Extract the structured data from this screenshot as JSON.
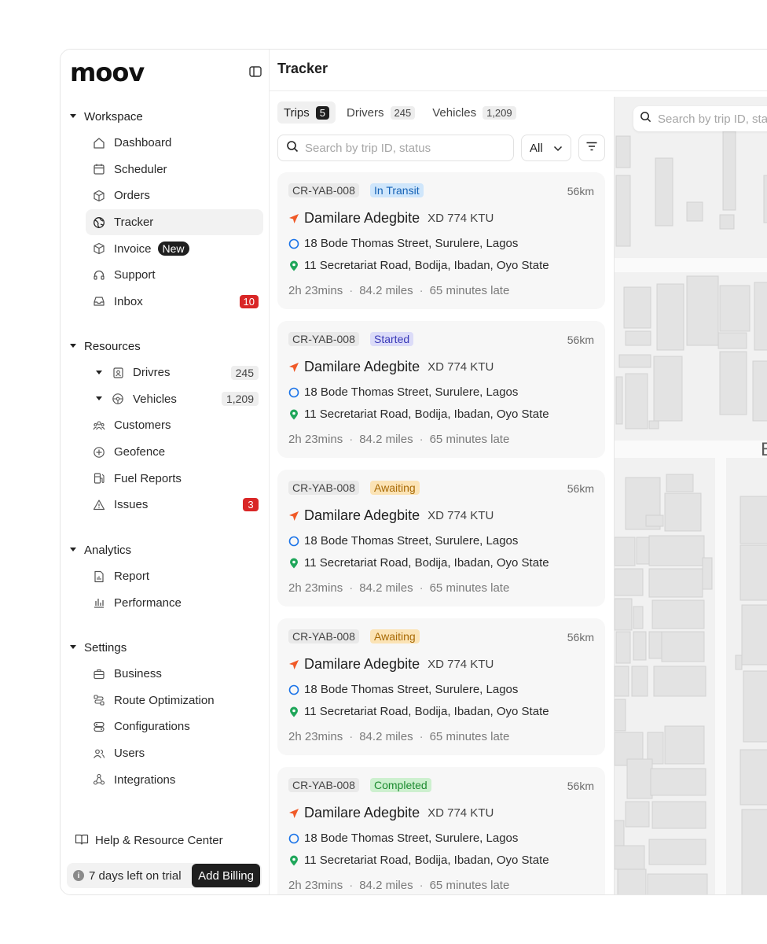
{
  "app": {
    "logo": "moov",
    "page_title": "Tracker"
  },
  "sidebar": {
    "sections": [
      {
        "title": "Workspace",
        "items": [
          {
            "label": "Dashboard",
            "icon": "home-icon"
          },
          {
            "label": "Scheduler",
            "icon": "calendar-icon"
          },
          {
            "label": "Orders",
            "icon": "box-icon"
          },
          {
            "label": "Tracker",
            "icon": "globe-icon",
            "active": true
          },
          {
            "label": "Invoice",
            "icon": "invoice-box-icon",
            "badge": "New"
          },
          {
            "label": "Support",
            "icon": "headset-icon"
          },
          {
            "label": "Inbox",
            "icon": "inbox-icon",
            "count": "10"
          }
        ]
      },
      {
        "title": "Resources",
        "items": [
          {
            "label": "Drivres",
            "icon": "id-badge-icon",
            "count": "245"
          },
          {
            "label": "Vehicles",
            "icon": "steering-wheel-icon",
            "count": "1,209"
          },
          {
            "label": "Customers",
            "icon": "users-group-icon"
          },
          {
            "label": "Geofence",
            "icon": "crosshair-icon"
          },
          {
            "label": "Fuel Reports",
            "icon": "fuel-icon"
          },
          {
            "label": "Issues",
            "icon": "warning-icon",
            "count": "3"
          }
        ]
      },
      {
        "title": "Analytics",
        "items": [
          {
            "label": "Report",
            "icon": "report-icon"
          },
          {
            "label": "Performance",
            "icon": "bar-chart-icon"
          }
        ]
      },
      {
        "title": "Settings",
        "items": [
          {
            "label": "Business",
            "icon": "briefcase-icon"
          },
          {
            "label": "Route Optimization",
            "icon": "route-icon"
          },
          {
            "label": "Configurations",
            "icon": "config-icon"
          },
          {
            "label": "Users",
            "icon": "users-icon"
          },
          {
            "label": "Integrations",
            "icon": "integrations-icon"
          }
        ]
      }
    ],
    "help": "Help & Resource Center",
    "trial": "7 days left on trial",
    "billing_button": "Add Billing"
  },
  "tabs": [
    {
      "label": "Trips",
      "count": "5",
      "active": true
    },
    {
      "label": "Drivers",
      "count": "245"
    },
    {
      "label": "Vehicles",
      "count": "1,209"
    }
  ],
  "search": {
    "placeholder": "Search by trip ID, status"
  },
  "filter": {
    "value": "All"
  },
  "map": {
    "search_placeholder": "Search by trip ID, sta",
    "label": "B"
  },
  "trips": [
    {
      "id": "CR-YAB-008",
      "status": "In Transit",
      "status_key": "transit",
      "distance": "56km",
      "driver": "Damilare Adegbite",
      "plate": "XD 774 KTU",
      "from": "18 Bode Thomas Street, Surulere, Lagos",
      "to": "11 Secretariat Road, Bodija, Ibadan, Oyo State",
      "duration": "2h 23mins",
      "miles": "84.2 miles",
      "late": "65 minutes late"
    },
    {
      "id": "CR-YAB-008",
      "status": "Started",
      "status_key": "started",
      "distance": "56km",
      "driver": "Damilare Adegbite",
      "plate": "XD 774 KTU",
      "from": "18 Bode Thomas Street, Surulere, Lagos",
      "to": "11 Secretariat Road, Bodija, Ibadan, Oyo State",
      "duration": "2h 23mins",
      "miles": "84.2 miles",
      "late": "65 minutes late"
    },
    {
      "id": "CR-YAB-008",
      "status": "Awaiting",
      "status_key": "awaiting",
      "distance": "56km",
      "driver": "Damilare Adegbite",
      "plate": "XD 774 KTU",
      "from": "18 Bode Thomas Street, Surulere, Lagos",
      "to": "11 Secretariat Road, Bodija, Ibadan, Oyo State",
      "duration": "2h 23mins",
      "miles": "84.2 miles",
      "late": "65 minutes late"
    },
    {
      "id": "CR-YAB-008",
      "status": "Awaiting",
      "status_key": "awaiting",
      "distance": "56km",
      "driver": "Damilare Adegbite",
      "plate": "XD 774 KTU",
      "from": "18 Bode Thomas Street, Surulere, Lagos",
      "to": "11 Secretariat Road, Bodija, Ibadan, Oyo State",
      "duration": "2h 23mins",
      "miles": "84.2 miles",
      "late": "65 minutes late"
    },
    {
      "id": "CR-YAB-008",
      "status": "Completed",
      "status_key": "completed",
      "distance": "56km",
      "driver": "Damilare Adegbite",
      "plate": "XD 774 KTU",
      "from": "18 Bode Thomas Street, Surulere, Lagos",
      "to": "11 Secretariat Road, Bodija, Ibadan, Oyo State",
      "duration": "2h 23mins",
      "miles": "84.2 miles",
      "late": "65 minutes late"
    }
  ],
  "colors": {
    "accent": "#1f1f1f",
    "alert": "#d92626",
    "nav_arrow": "#f05a28",
    "origin": "#1a73e8",
    "destination": "#1fa65a"
  }
}
